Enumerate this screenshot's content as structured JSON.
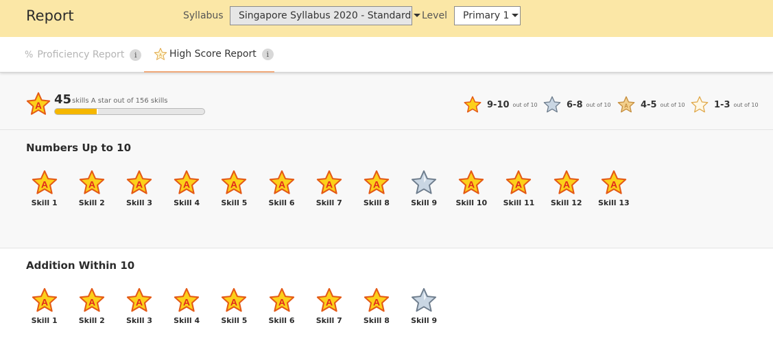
{
  "header": {
    "title": "Report",
    "syllabus_label": "Syllabus",
    "syllabus_value": "Singapore Syllabus 2020 - Standard",
    "level_label": "Level",
    "level_value": "Primary 1"
  },
  "tabs": [
    {
      "icon": "percent-icon",
      "label": "Proficiency Report",
      "active": false
    },
    {
      "icon": "star-outline-icon",
      "label": "High Score Report",
      "active": true
    }
  ],
  "info_glyph": "i",
  "summary": {
    "count": "45",
    "text": "skills A star out of 156 skills",
    "progress_fraction": 0.2885,
    "legend": [
      {
        "icon": "gold-star-icon",
        "range": "9-10",
        "suffix": "out of 10"
      },
      {
        "icon": "silver-star-icon",
        "range": "6-8",
        "suffix": "out of 10"
      },
      {
        "icon": "bronze-star-icon",
        "range": "4-5",
        "suffix": "out of 10"
      },
      {
        "icon": "outline-star-icon",
        "range": "1-3",
        "suffix": "out of 10"
      }
    ]
  },
  "sections": [
    {
      "title": "Numbers Up to 10",
      "skills": [
        {
          "name": "Skill 1",
          "star": "gold"
        },
        {
          "name": "Skill 2",
          "star": "gold"
        },
        {
          "name": "Skill 3",
          "star": "gold"
        },
        {
          "name": "Skill 4",
          "star": "gold"
        },
        {
          "name": "Skill 5",
          "star": "gold"
        },
        {
          "name": "Skill 6",
          "star": "gold"
        },
        {
          "name": "Skill 7",
          "star": "gold"
        },
        {
          "name": "Skill 8",
          "star": "gold"
        },
        {
          "name": "Skill 9",
          "star": "silver"
        },
        {
          "name": "Skill 10",
          "star": "gold"
        },
        {
          "name": "Skill 11",
          "star": "gold"
        },
        {
          "name": "Skill 12",
          "star": "gold"
        },
        {
          "name": "Skill 13",
          "star": "gold"
        }
      ]
    },
    {
      "title": "Addition Within 10",
      "skills": [
        {
          "name": "Skill 1",
          "star": "gold"
        },
        {
          "name": "Skill 2",
          "star": "gold"
        },
        {
          "name": "Skill 3",
          "star": "gold"
        },
        {
          "name": "Skill 4",
          "star": "gold"
        },
        {
          "name": "Skill 5",
          "star": "gold"
        },
        {
          "name": "Skill 6",
          "star": "gold"
        },
        {
          "name": "Skill 7",
          "star": "gold"
        },
        {
          "name": "Skill 8",
          "star": "gold"
        },
        {
          "name": "Skill 9",
          "star": "silver"
        }
      ]
    }
  ],
  "colors": {
    "header_bg": "#fbe7a6",
    "gold": "#fcd01a",
    "silver": "#c9d6e3",
    "progress": "#f5b700",
    "tab_underline": "#f0a878"
  }
}
